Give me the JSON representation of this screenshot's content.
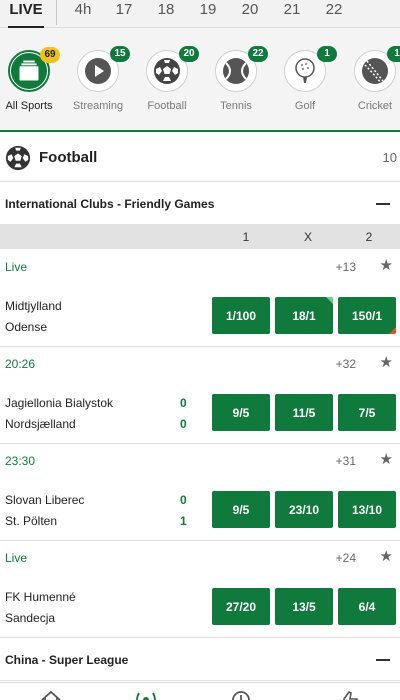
{
  "time_filters": {
    "live": "LIVE",
    "items": [
      "4h",
      "17",
      "18",
      "19",
      "20",
      "21",
      "22"
    ]
  },
  "sports": [
    {
      "label": "All Sports",
      "count": "69",
      "icon": "all-sports-icon",
      "active": true
    },
    {
      "label": "Streaming",
      "count": "15",
      "icon": "play-icon",
      "active": false
    },
    {
      "label": "Football",
      "count": "20",
      "icon": "football-icon",
      "active": false
    },
    {
      "label": "Tennis",
      "count": "22",
      "icon": "tennis-ball-icon",
      "active": false
    },
    {
      "label": "Golf",
      "count": "1",
      "icon": "golf-ball-icon",
      "active": false
    },
    {
      "label": "Cricket",
      "count": "1",
      "icon": "cricket-ball-icon",
      "active": false
    }
  ],
  "section": {
    "title": "Football",
    "count": "10"
  },
  "competitions": [
    {
      "name": "International Clubs - Friendly Games"
    },
    {
      "name": "China - Super League"
    }
  ],
  "columns": [
    "1",
    "X",
    "2"
  ],
  "events": [
    {
      "status": "Live",
      "more": "+13",
      "home": "Midtjylland",
      "away": "Odense",
      "home_score": "",
      "away_score": "",
      "odds": [
        "1/100",
        "18/1",
        "150/1"
      ]
    },
    {
      "status": "20:26",
      "more": "+32",
      "home": "Jagiellonia Bialystok",
      "away": "Nordsjælland",
      "home_score": "0",
      "away_score": "0",
      "odds": [
        "9/5",
        "11/5",
        "7/5"
      ]
    },
    {
      "status": "23:30",
      "more": "+31",
      "home": "Slovan Liberec",
      "away": "St. Pölten",
      "home_score": "0",
      "away_score": "1",
      "odds": [
        "9/5",
        "23/10",
        "13/10"
      ]
    },
    {
      "status": "Live",
      "more": "+24",
      "home": "FK Humenné",
      "away": "Sandecja",
      "home_score": "",
      "away_score": "",
      "odds": [
        "27/20",
        "13/5",
        "6/4"
      ]
    }
  ],
  "colors": {
    "brand_green": "#107a3c",
    "badge_yellow": "#f0c21d",
    "odds_up": "#6fd08c",
    "odds_down": "#e0542b"
  },
  "bottom_nav": [
    "home-icon",
    "live-icon",
    "clock-icon",
    "promotions-icon"
  ]
}
